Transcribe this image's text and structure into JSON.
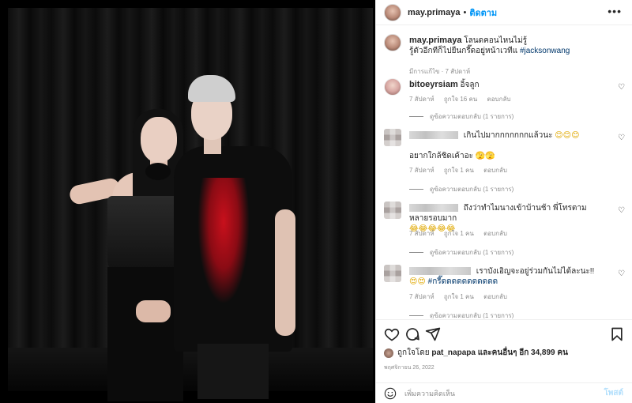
{
  "header": {
    "username": "may.primaya",
    "separator": "•",
    "follow_label": "ติดตาม",
    "more_label": "•••"
  },
  "caption": {
    "username": "may.primaya",
    "line1": "โลนดคอนไหนไม่รู้",
    "line2": "รู้ตัวอีกทีก็ไปยืนกรี๊ดอยู่หน้าเวทีแ",
    "hashtag": "#jacksonwang",
    "meta": "มีการแก้ไข · 7 สัปดาห์"
  },
  "comments": [
    {
      "username": "bitoeyrsiam",
      "text": "อิ้จลูก",
      "time": "7 สัปดาห์",
      "likes": "ถูกใจ 16 คน",
      "reply": "ตอบกลับ",
      "view_replies": "ดูข้อความตอบกลับ (1 รายการ)",
      "emoji": ""
    },
    {
      "username": "",
      "text": "เกินไปมากกกกกกกแล้วนะ",
      "text2": "อยากใกล้ชิดเค้าอะ 🫣🫣",
      "emoji": "😊😊😊",
      "time": "7 สัปดาห์",
      "likes": "ถูกใจ 1 คน",
      "reply": "ตอบกลับ",
      "view_replies": "ดูข้อความตอบกลับ (1 รายการ)"
    },
    {
      "username": "",
      "text": "ถึงว่าทำไมนางเข้าบ้านช้า พี่โทรตามหลายรอบมาก",
      "emoji": "😂😂😂😂😂",
      "time": "7 สัปดาห์",
      "likes": "ถูกใจ 1 คน",
      "reply": "ตอบกลับ",
      "view_replies": "ดูข้อความตอบกลับ (1 รายการ)"
    },
    {
      "username": "",
      "text": "เราบังเอิญจะอยู่ร่วมกันไม่ได้ละนะ!!",
      "emoji": "😍😍",
      "hashtag": "#กรี๊ดดดดดดดดดดด",
      "time": "7 สัปดาห์",
      "likes": "ถูกใจ 1 คน",
      "reply": "ตอบกลับ",
      "view_replies": "ดูข้อความตอบกลับ (1 รายการ)"
    }
  ],
  "likes": {
    "prefix": "ถูกใจโดย",
    "user": "pat_napapa",
    "middle": "และคนอื่นๆ",
    "count_prefix": "อีก",
    "count": "34,899",
    "suffix": "คน"
  },
  "date": "พฤศจิกายน 26, 2022",
  "comment_input": {
    "placeholder": "เพิ่มความคิดเห็น",
    "post_label": "โพสต์"
  },
  "colors": {
    "link": "#0095f6",
    "hashtag": "#00376b",
    "muted": "#8e8e8e",
    "post_disabled": "#b2dffc"
  }
}
